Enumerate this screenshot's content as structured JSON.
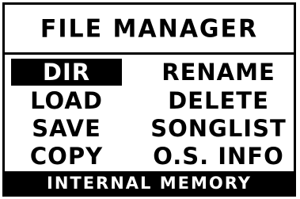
{
  "window": {
    "title": "FILE MANAGER"
  },
  "menu": {
    "left_items": [
      {
        "label": "DIR",
        "selected": true
      },
      {
        "label": "LOAD",
        "selected": false
      },
      {
        "label": "SAVE",
        "selected": false
      },
      {
        "label": "COPY",
        "selected": false
      }
    ],
    "right_items": [
      {
        "label": "RENAME",
        "selected": false
      },
      {
        "label": "DELETE",
        "selected": false
      },
      {
        "label": "SONGLIST",
        "selected": false
      },
      {
        "label": "O.S. INFO",
        "selected": false
      }
    ]
  },
  "status": {
    "text": "INTERNAL MEMORY"
  },
  "colors": {
    "foreground": "#000000",
    "background": "#ffffff"
  }
}
